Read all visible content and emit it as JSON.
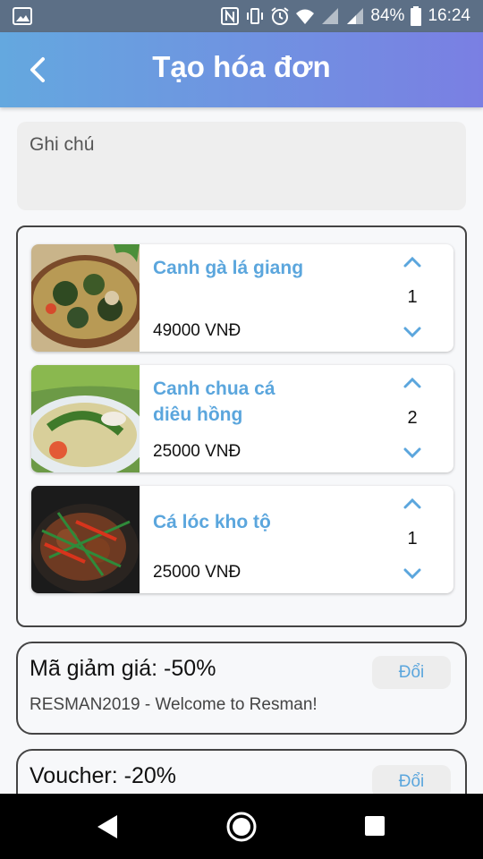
{
  "status_bar": {
    "battery": "84%",
    "time": "16:24",
    "icons": [
      "image-icon",
      "nfc-icon",
      "vibrate-icon",
      "alarm-icon",
      "wifi-icon",
      "signal-icon",
      "signal-icon",
      "battery-icon"
    ]
  },
  "header": {
    "title": "Tạo hóa đơn",
    "back_icon": "arrow-left-icon"
  },
  "note": {
    "placeholder": "Ghi chú"
  },
  "order": {
    "items": [
      {
        "name": "Canh gà lá giang",
        "price": "49000 VNĐ",
        "quantity": "1"
      },
      {
        "name": "Canh chua cá diêu hồng",
        "price": "25000 VNĐ",
        "quantity": "2"
      },
      {
        "name": "Cá lóc kho tộ",
        "price": "25000 VNĐ",
        "quantity": "1"
      }
    ]
  },
  "discount": {
    "title": "Mã giảm giá: -50%",
    "description": "RESMAN2019 - Welcome to Resman!",
    "button": "Đổi"
  },
  "voucher": {
    "title": "Voucher: -20%",
    "button": "Đổi"
  },
  "colors": {
    "accent": "#5ba6dd",
    "header_start": "#64a8df",
    "header_end": "#7a7fe3"
  }
}
